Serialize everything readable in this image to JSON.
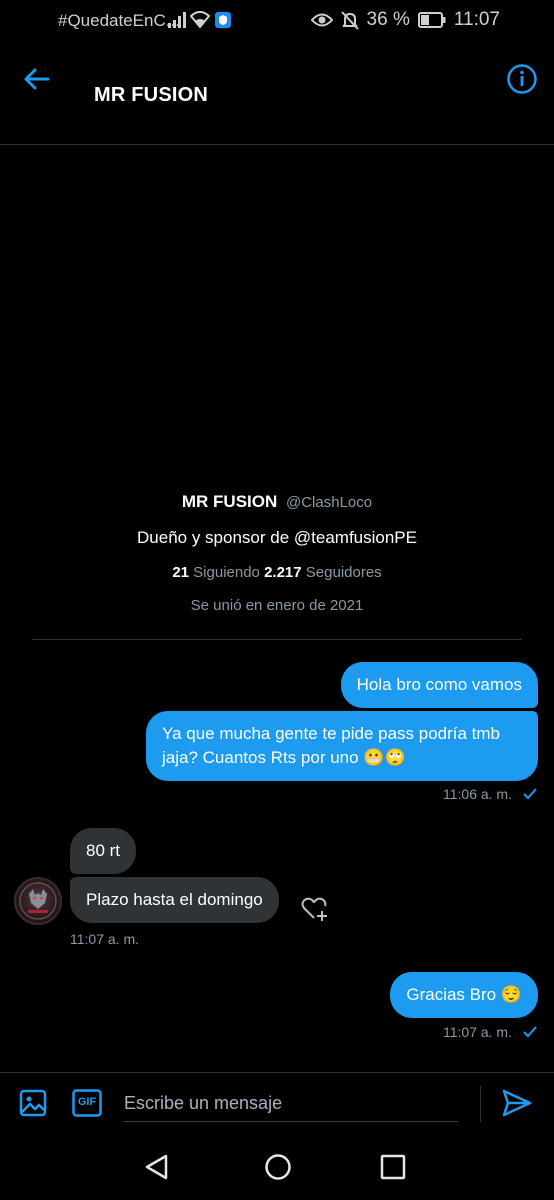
{
  "status_bar": {
    "notification_text": "#QuedateEnC...",
    "battery_percent": "36 %",
    "time": "11:07",
    "icons": [
      "signal-icon",
      "wifi-icon",
      "shield-app-icon",
      "eye-icon",
      "bell-off-icon",
      "battery-icon"
    ]
  },
  "header": {
    "title": "MR FUSION",
    "back_icon": "arrow-left-icon",
    "info_icon": "info-icon"
  },
  "profile": {
    "name": "MR FUSION",
    "handle": "@ClashLoco",
    "bio": "Dueño y sponsor de @teamfusionPE",
    "following_count": "21",
    "following_label": "Siguiendo",
    "followers_count": "2.217",
    "followers_label": "Seguidores",
    "joined": "Se unió en enero de 2021"
  },
  "messages": {
    "m1": "Hola bro como vamos",
    "m2": "Ya que mucha gente te pide pass podría tmb jaja? Cuantos Rts por uno 😬🙄",
    "m2_time": "11:06 a. m.",
    "m3": "80 rt",
    "m4": "Plazo hasta el domingo",
    "m4_time": "11:07 a. m.",
    "m5": "Gracias Bro 😌",
    "m5_time": "11:07 a. m."
  },
  "composer": {
    "placeholder": "Escribe un mensaje",
    "value": "",
    "gif_label": "GIF"
  },
  "colors": {
    "accent": "#1d9bf0",
    "background": "#000000",
    "incoming_bubble": "#2f3336",
    "muted_text": "#8b98a5"
  }
}
